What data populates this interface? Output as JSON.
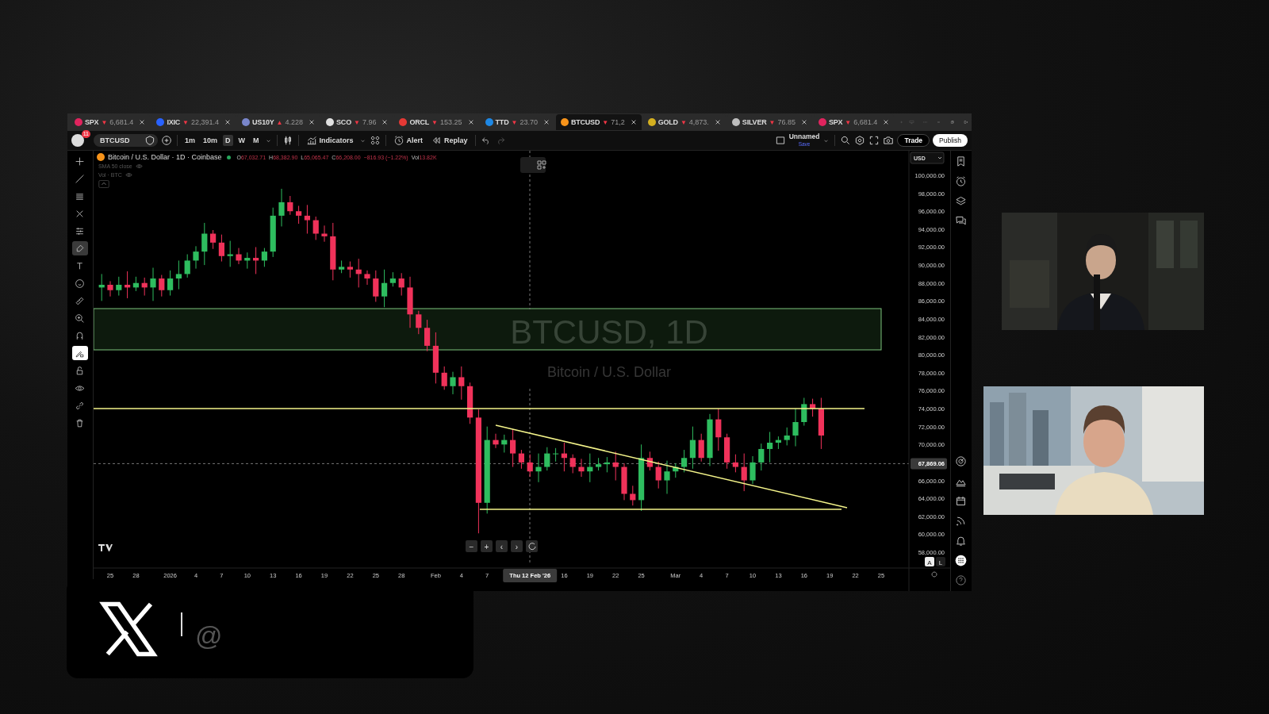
{
  "tabs": [
    {
      "symbol": "SPX",
      "value": "6,681.4",
      "direction": "▼",
      "color": "#e0245e",
      "selected": false
    },
    {
      "symbol": "IXIC",
      "value": "22,391.4",
      "direction": "▼",
      "color": "#2962ff",
      "selected": false
    },
    {
      "symbol": "US10Y",
      "value": "4.228",
      "direction": "▲",
      "color": "#7986cb",
      "selected": false
    },
    {
      "symbol": "SCO",
      "value": "7.96",
      "direction": "▼",
      "color": "#e0e0e0",
      "selected": false
    },
    {
      "symbol": "ORCL",
      "value": "153.25",
      "direction": "▼",
      "color": "#e53935",
      "selected": false
    },
    {
      "symbol": "TTD",
      "value": "23.70",
      "direction": "▼",
      "color": "#1e88e5",
      "selected": false
    },
    {
      "symbol": "BTCUSD",
      "value": "71,2",
      "direction": "▼",
      "color": "#f7931a",
      "selected": true
    },
    {
      "symbol": "GOLD",
      "value": "4,873.",
      "direction": "▼",
      "color": "#d4b020",
      "selected": false
    },
    {
      "symbol": "SILVER",
      "value": "76.85",
      "direction": "▼",
      "color": "#bdbdbd",
      "selected": false
    },
    {
      "symbol": "SPX",
      "value": "6,681.4",
      "direction": "▼",
      "color": "#e0245e",
      "selected": false
    }
  ],
  "toolbar": {
    "avatar_badge": "11",
    "symbol": "BTCUSD",
    "intervals": [
      {
        "label": "1m",
        "selected": false
      },
      {
        "label": "10m",
        "selected": false
      },
      {
        "label": "D",
        "selected": true
      },
      {
        "label": "W",
        "selected": false
      },
      {
        "label": "M",
        "selected": false
      }
    ],
    "indicators": "Indicators",
    "alert": "Alert",
    "replay": "Replay",
    "layout_name": "Unnamed",
    "layout_status": "Save",
    "trade": "Trade",
    "publish": "Publish"
  },
  "drawing_tools": [
    {
      "kind": "crosshair",
      "selected": false
    },
    {
      "kind": "trend",
      "selected": false
    },
    {
      "kind": "lines",
      "selected": false
    },
    {
      "kind": "pattern",
      "selected": false
    },
    {
      "kind": "fib",
      "selected": false
    },
    {
      "kind": "brush",
      "selected": true
    },
    {
      "kind": "text",
      "selected": false
    },
    {
      "kind": "emoji",
      "selected": false
    },
    {
      "kind": "ruler",
      "selected": false
    },
    {
      "kind": "zoom",
      "selected": false
    },
    {
      "kind": "magnet",
      "selected": false
    },
    {
      "kind": "pencil-lock",
      "selected": true
    },
    {
      "kind": "lock",
      "selected": false
    },
    {
      "kind": "eye",
      "selected": false
    },
    {
      "kind": "link",
      "selected": false
    },
    {
      "kind": "trash",
      "selected": false
    }
  ],
  "legend": {
    "title": "Bitcoin / U.S. Dollar · 1D · Coinbase",
    "ohlc": [
      {
        "prefix": "O",
        "value": "67,032.71"
      },
      {
        "prefix": "H",
        "value": "68,382.90"
      },
      {
        "prefix": "L",
        "value": "65,065.47"
      },
      {
        "prefix": "C",
        "value": "66,208.00"
      }
    ],
    "change": "−816.93 (−1.22%)",
    "volume_label": "Vol",
    "volume": "13.82K",
    "indicators": [
      "SMA 50 close",
      "Vol · BTC"
    ]
  },
  "chart": {
    "watermark_symbol": "BTCUSD, 1D",
    "watermark_name": "Bitcoin / U.S. Dollar",
    "currency": "USD",
    "price_labels": [
      "100,000.00",
      "98,000.00",
      "96,000.00",
      "94,000.00",
      "92,000.00",
      "90,000.00",
      "88,000.00",
      "86,000.00",
      "84,000.00",
      "82,000.00",
      "80,000.00",
      "78,000.00",
      "76,000.00",
      "74,000.00",
      "72,000.00",
      "70,000.00",
      "66,000.00",
      "64,000.00",
      "62,000.00",
      "60,000.00",
      "58,000.00"
    ],
    "current_price": "67,869.06",
    "time_labels": [
      {
        "label": "25",
        "highlighted": false
      },
      {
        "label": "28",
        "highlighted": false
      },
      {
        "label": "2026",
        "highlighted": false
      },
      {
        "label": "4",
        "highlighted": false
      },
      {
        "label": "7",
        "highlighted": false
      },
      {
        "label": "10",
        "highlighted": false
      },
      {
        "label": "13",
        "highlighted": false
      },
      {
        "label": "16",
        "highlighted": false
      },
      {
        "label": "19",
        "highlighted": false
      },
      {
        "label": "22",
        "highlighted": false
      },
      {
        "label": "25",
        "highlighted": false
      },
      {
        "label": "28",
        "highlighted": false
      },
      {
        "label": "Feb",
        "highlighted": false
      },
      {
        "label": "4",
        "highlighted": false
      },
      {
        "label": "7",
        "highlighted": false
      },
      {
        "label": "Thu 12 Feb '26",
        "highlighted": true
      },
      {
        "label": "16",
        "highlighted": false
      },
      {
        "label": "19",
        "highlighted": false
      },
      {
        "label": "22",
        "highlighted": false
      },
      {
        "label": "25",
        "highlighted": false
      },
      {
        "label": "Mar",
        "highlighted": false
      },
      {
        "label": "4",
        "highlighted": false
      },
      {
        "label": "7",
        "highlighted": false
      },
      {
        "label": "10",
        "highlighted": false
      },
      {
        "label": "13",
        "highlighted": false
      },
      {
        "label": "16",
        "highlighted": false
      },
      {
        "label": "19",
        "highlighted": false
      },
      {
        "label": "22",
        "highlighted": false
      },
      {
        "label": "25",
        "highlighted": false
      }
    ],
    "nav": [
      "−",
      "+",
      "‹",
      "›"
    ],
    "scale_buttons": [
      {
        "label": "A",
        "selected": true
      },
      {
        "label": "L",
        "selected": false
      }
    ]
  },
  "social": {
    "handle": "@"
  }
}
